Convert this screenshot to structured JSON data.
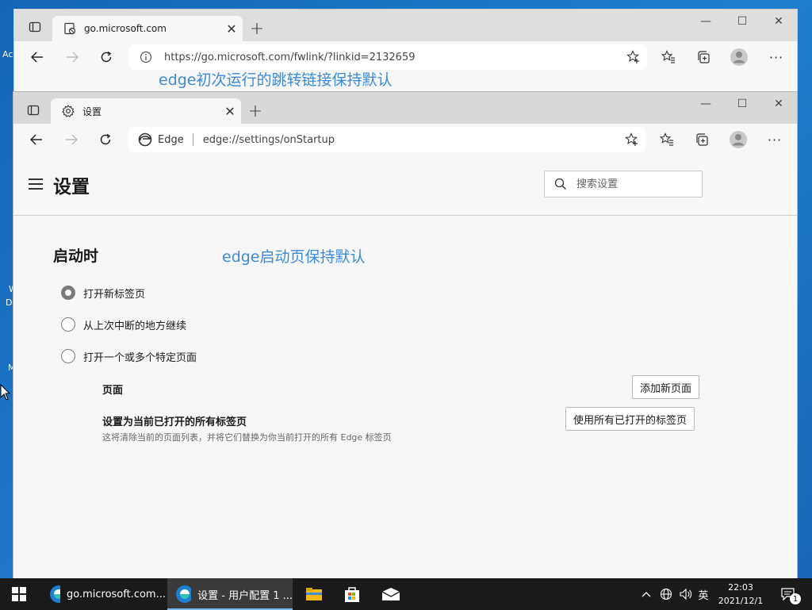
{
  "desktop": {
    "fragments": [
      "Ac",
      "W",
      "D",
      "M"
    ]
  },
  "back_window": {
    "tab_title": "go.microsoft.com",
    "url": "https://go.microsoft.com/fwlink/?linkid=2132659"
  },
  "front_window": {
    "tab_title": "设置",
    "site_label": "Edge",
    "url": "edge://settings/onStartup"
  },
  "annotations": {
    "top": "edge初次运行的跳转链接保持默认",
    "startup": "edge启动页保持默认"
  },
  "settings": {
    "title": "设置",
    "search_placeholder": "搜索设置",
    "section_title": "启动时",
    "options": [
      {
        "label": "打开新标签页",
        "selected": true
      },
      {
        "label": "从上次中断的地方继续",
        "selected": false
      },
      {
        "label": "打开一个或多个特定页面",
        "selected": false
      }
    ],
    "pages_label": "页面",
    "add_page_button": "添加新页面",
    "use_open_tabs_label": "设置为当前已打开的所有标签页",
    "use_open_tabs_desc": "这将清除当前的页面列表，并将它们替换为你当前打开的所有 Edge 标签页",
    "use_open_tabs_button": "使用所有已打开的标签页"
  },
  "taskbar": {
    "apps": [
      {
        "label": "go.microsoft.com...",
        "active": false
      },
      {
        "label": "设置 - 用户配置 1 ...",
        "active": true
      }
    ],
    "ime": "英",
    "time": "22:03",
    "date": "2021/12/1",
    "notification_count": "1"
  },
  "colors": {
    "annotation": "#3a8ad8",
    "taskbar": "#1a1a1a",
    "desktop": "#1f6fb2"
  }
}
